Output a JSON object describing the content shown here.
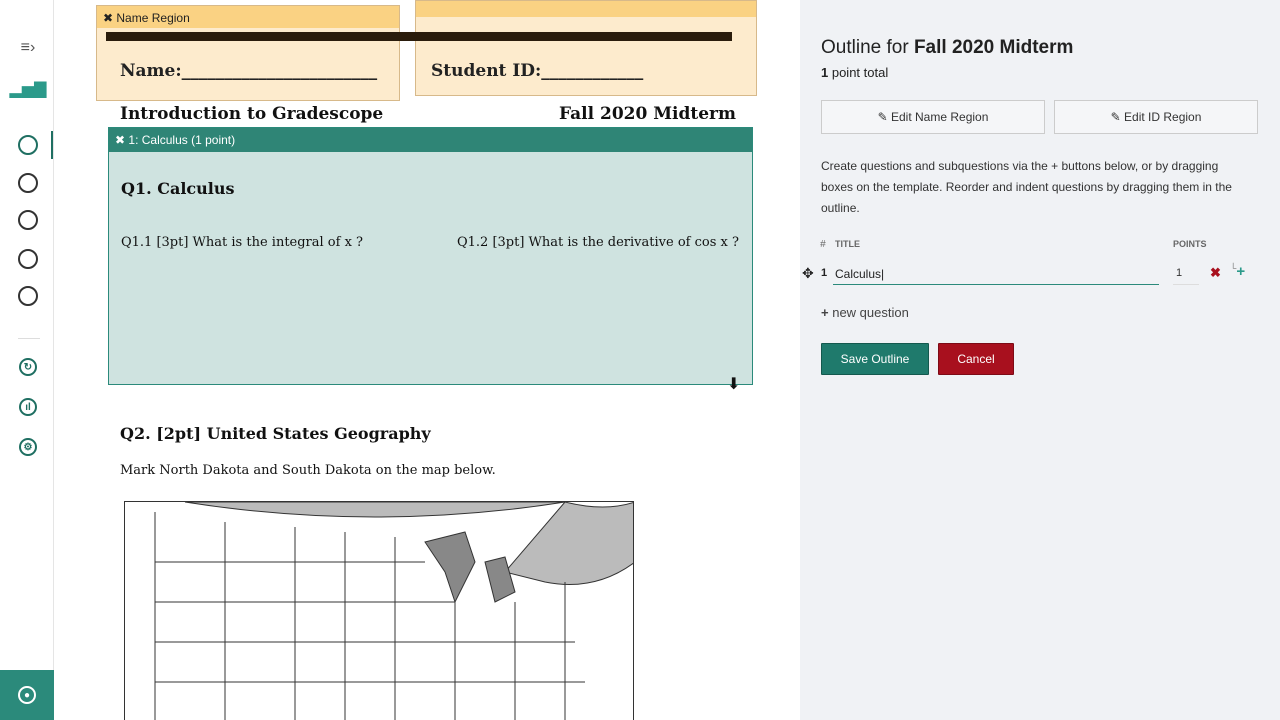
{
  "sidebar": {
    "icons": [
      "menu-expand-icon",
      "stats-icon",
      "circle-icon",
      "circle-icon",
      "circle-icon",
      "circle-icon",
      "circle-icon",
      "refresh-icon",
      "chart-icon",
      "gear-icon",
      "user-icon"
    ]
  },
  "document": {
    "name_region_label": "Name Region",
    "name_field": "Name:_______________________",
    "student_id_field": "Student ID:____________",
    "course_title": "Introduction to Gradescope",
    "exam_title": "Fall 2020 Midterm",
    "question_box_label": "1: Calculus (1 point)",
    "q1_title": "Q1. Calculus",
    "q1_1": "Q1.1  [3pt] What is the integral of x ?",
    "q1_2": "Q1.2 [3pt] What is the derivative of cos x ?",
    "q2_title": "Q2. [2pt] United States Geography",
    "q2_text": "Mark North Dakota and South Dakota on the map below."
  },
  "panel": {
    "title_prefix": "Outline for ",
    "title_bold": "Fall 2020 Midterm",
    "points_num": "1",
    "points_text": " point total",
    "edit_name": "Edit Name Region",
    "edit_id": "Edit ID Region",
    "help": "Create questions and subquestions via the + buttons below, or by dragging boxes on the template. Reorder and indent questions by dragging them in the outline.",
    "col_num": "#",
    "col_title": "TITLE",
    "col_points": "POINTS",
    "questions": [
      {
        "num": "1",
        "title": "Calculus",
        "points": "1"
      }
    ],
    "new_question": "new question",
    "save": "Save Outline",
    "cancel": "Cancel"
  },
  "colors": {
    "accent": "#1f7a6c",
    "danger": "#a8101e",
    "region": "#fad283",
    "question": "#cfe3e0"
  }
}
